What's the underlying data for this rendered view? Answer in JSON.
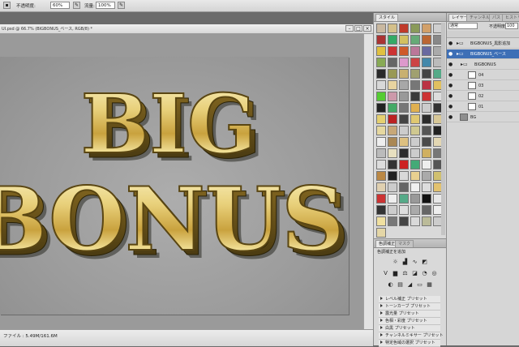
{
  "options_bar": {
    "opacity_label": "不透明度:",
    "opacity_value": "60%",
    "flow_label": "流量:",
    "flow_value": "100%"
  },
  "document": {
    "title": "UI.psd @ 66.7% (BIGBONUS_ベース, RGB/8) *",
    "status": "ファイル : 5.49M/161.6M",
    "artwork_line1": "BIG",
    "artwork_line2": "BONUS"
  },
  "styles_panel": {
    "tabs": [
      "スタイル",
      ""
    ],
    "swatches": [
      "#c9b8a0",
      "#d4c08a",
      "#c03a2a",
      "#8a9a5a",
      "#d2a06a",
      "#cfcfcf",
      "#a33",
      "#3a6",
      "#d2c060",
      "#6a7",
      "#b63",
      "#888",
      "#e0c040",
      "#c33",
      "#cf5a2a",
      "#b79",
      "#6a6aa0",
      "#aaa",
      "#8a5",
      "#666",
      "#d9c",
      "#c44",
      "#48a",
      "#bbb",
      "#2a2a2a",
      "#995",
      "#c8b070",
      "#a0a070",
      "#444",
      "#5a8",
      "#d8d8d8",
      "#e8d4a0",
      "#a8a8a8",
      "#777",
      "#b34",
      "#e0c060",
      "#5c3",
      "#c9a",
      "#999",
      "#3a3a3a",
      "#c33",
      "#ddd",
      "#222",
      "#4a6",
      "#777",
      "#e0b050",
      "#ccc",
      "#333",
      "#e5d070",
      "#b22",
      "#444",
      "#e0c870",
      "#2b2b2b",
      "#d8c898",
      "#e6d8a0",
      "#c8a878",
      "#ccc",
      "#cfc890",
      "#555",
      "#222",
      "#eeeeee",
      "#a85",
      "#ddc080",
      "#ccc",
      "#4a4a4a",
      "#e3d7b3",
      "#bbb",
      "#e8e0c0",
      "#2c2c2c",
      "#ccc",
      "#d0b060",
      "#777",
      "#ddd",
      "#333",
      "#c22",
      "#4a7",
      "#eee",
      "#555",
      "#b84",
      "#222",
      "#d8d8d8",
      "#e8d090",
      "#aaa",
      "#d0c070",
      "#e0d0b0",
      "#ccc",
      "#666",
      "#f0f0f0",
      "#ddd",
      "#e2c270",
      "#c33",
      "#eee",
      "#5a8",
      "#999",
      "#111",
      "#e8e8e8",
      "#333",
      "#ccc",
      "#ddd",
      "#aaa",
      "#666",
      "#eee",
      "#f0e0a0",
      "#777",
      "#444",
      "#d9d9d9",
      "#bb9",
      "#ccc",
      "#e4d6a6"
    ]
  },
  "layers_panel": {
    "tabs": [
      "レイヤー",
      "チャンネル",
      "パス",
      "ヒストリー"
    ],
    "blend_mode": "通常",
    "opacity_label": "不透明度",
    "opacity_value": "100",
    "layers": [
      {
        "name": "BIGBONUS_黒影追加",
        "type": "group"
      },
      {
        "name": "BIGBONUS_ベース",
        "type": "group",
        "selected": true
      },
      {
        "name": "BIGBONUS",
        "type": "group"
      },
      {
        "name": "04",
        "type": "layer"
      },
      {
        "name": "03",
        "type": "layer"
      },
      {
        "name": "02",
        "type": "layer"
      },
      {
        "name": "01",
        "type": "layer"
      },
      {
        "name": "BG",
        "type": "layer"
      }
    ]
  },
  "adjustments_panel": {
    "tabs": [
      "色調補正",
      "マスク"
    ],
    "heading": "色調補正を追加",
    "presets": [
      "レベル補正 プリセット",
      "トーンカーブ プリセット",
      "露光量 プリセット",
      "色相・彩度 プリセット",
      "白黒 プリセット",
      "チャンネルミキサー プリセット",
      "特定色域の選択 プリセット"
    ]
  },
  "colors": {
    "selection": "#3d6fb6",
    "gold_light": "#f7ecb0",
    "gold_mid": "#d6b54f",
    "gold_dark": "#6a5418"
  }
}
